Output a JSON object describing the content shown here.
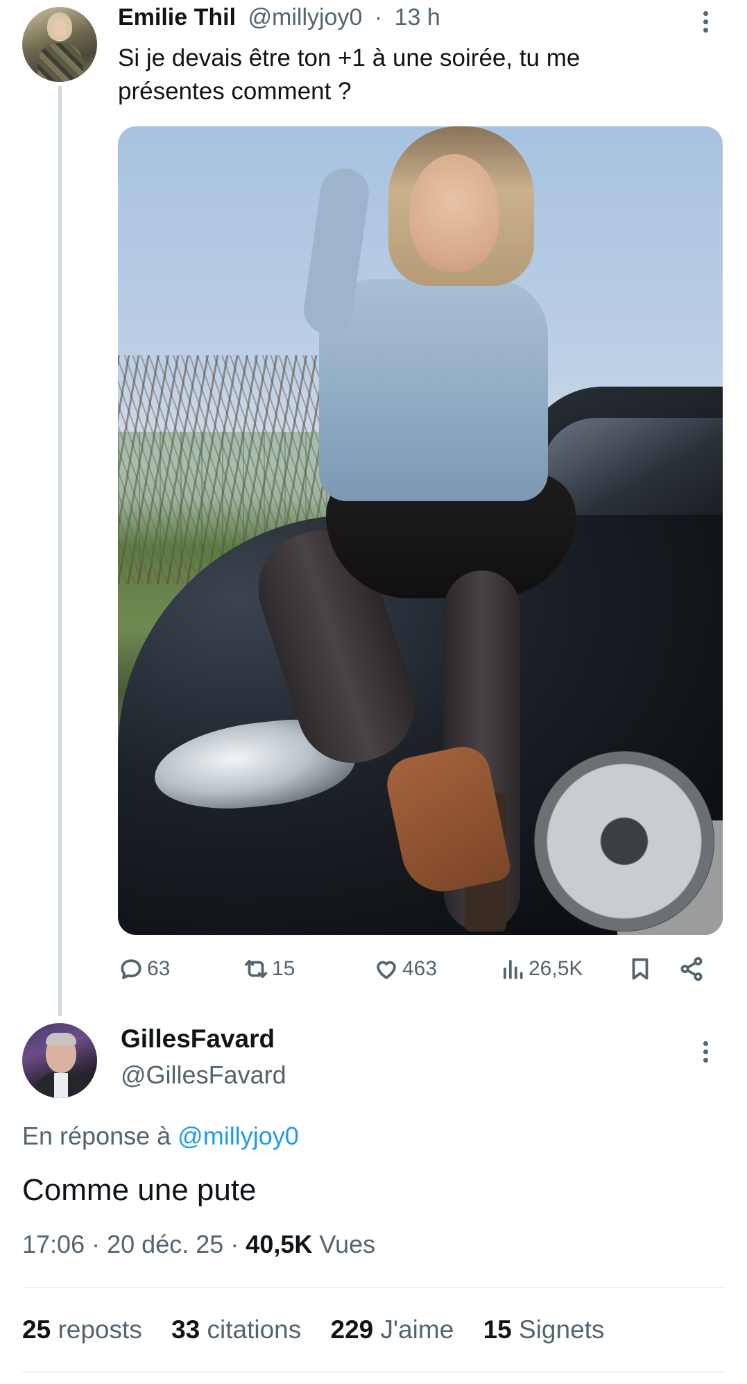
{
  "parent_tweet": {
    "author_name": "Emilie Thil",
    "author_handle": "@millyjoy0",
    "separator": "·",
    "time": "13 h",
    "text": "Si je devais être ton +1 à une soirée, tu me présentes comment ?",
    "actions": {
      "replies": "63",
      "reposts": "15",
      "likes": "463",
      "views": "26,5K"
    },
    "icons": [
      "reply-icon",
      "repost-icon",
      "like-icon",
      "views-icon",
      "bookmark-icon",
      "share-icon",
      "more-icon"
    ]
  },
  "reply_tweet": {
    "author_name": "GillesFavard",
    "author_handle": "@GillesFavard",
    "in_reply_prefix": "En réponse à",
    "in_reply_handle": "@millyjoy0",
    "text": "Comme une pute",
    "time": "17:06",
    "dot": "·",
    "date": "20 déc. 25",
    "views_count": "40,5K",
    "views_label": "Vues",
    "stats": [
      {
        "count": "25",
        "label": "reposts"
      },
      {
        "count": "33",
        "label": "citations"
      },
      {
        "count": "229",
        "label": "J'aime"
      },
      {
        "count": "15",
        "label": "Signets"
      }
    ]
  },
  "colors": {
    "text": "#0f1419",
    "muted": "#536471",
    "link": "#1d9bf0",
    "divider": "#eff3f4",
    "thread_line": "#cfd9de"
  }
}
